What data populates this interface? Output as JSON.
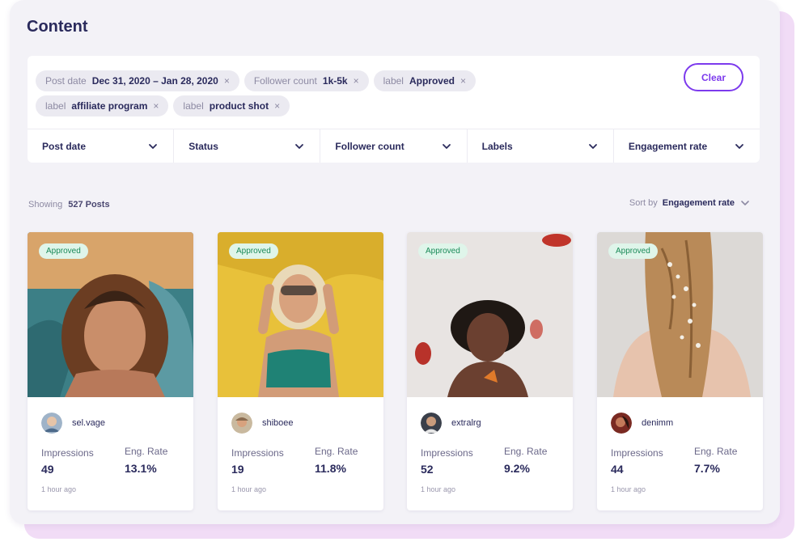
{
  "page": {
    "title": "Content"
  },
  "filters": {
    "chips": [
      {
        "key": "Post date",
        "value": "Dec 31, 2020 – Jan 28, 2020"
      },
      {
        "key": "Follower count",
        "value": "1k-5k"
      },
      {
        "key": "label",
        "value": "Approved"
      },
      {
        "key": "label",
        "value": "affiliate program"
      },
      {
        "key": "label",
        "value": "product shot"
      }
    ],
    "remove_glyph": "×",
    "clear_label": "Clear",
    "dropdowns": [
      "Post date",
      "Status",
      "Follower count",
      "Labels",
      "Engagement rate"
    ]
  },
  "results": {
    "showing_label": "Showing",
    "count": "527 Posts",
    "sort_label": "Sort by",
    "sort_value": "Engagement rate"
  },
  "stat_labels": {
    "impressions": "Impressions",
    "eng_rate": "Eng. Rate"
  },
  "posts": [
    {
      "status": "Approved",
      "username": "sel.vage",
      "impressions": "49",
      "eng_rate": "13.1%",
      "time": "1 hour ago"
    },
    {
      "status": "Approved",
      "username": "shiboee",
      "impressions": "19",
      "eng_rate": "11.8%",
      "time": "1 hour ago"
    },
    {
      "status": "Approved",
      "username": "extralrg",
      "impressions": "52",
      "eng_rate": "9.2%",
      "time": "1 hour ago"
    },
    {
      "status": "Approved",
      "username": "denimm",
      "impressions": "44",
      "eng_rate": "7.7%",
      "time": "1 hour ago"
    }
  ],
  "icons": {
    "chevron": "chevron-down-icon",
    "remove": "close-icon"
  },
  "colors": {
    "accent": "#7c3aed",
    "badge_bg": "#dff5ea",
    "badge_text": "#1a8a58",
    "title": "#2a2a5c"
  }
}
